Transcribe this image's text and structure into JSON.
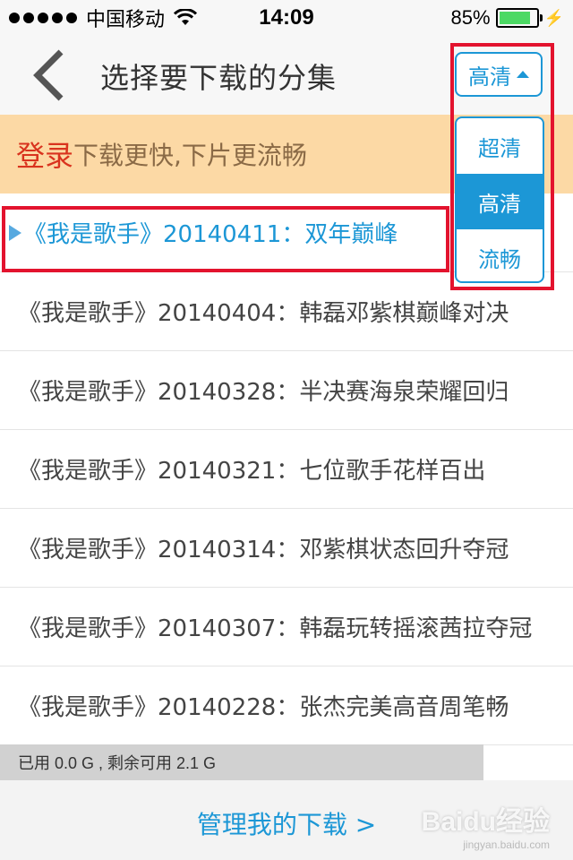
{
  "status_bar": {
    "carrier": "中国移动",
    "time": "14:09",
    "battery_percent": "85%",
    "battery_level": 0.85
  },
  "nav": {
    "title": "选择要下载的分集",
    "quality_selected": "高清",
    "back_icon": "chevron-left-icon"
  },
  "banner": {
    "login": "登录",
    "text": "下载更快,下片更流畅"
  },
  "quality_dropdown": {
    "options": [
      "超清",
      "高清",
      "流畅"
    ],
    "selected_index": 1
  },
  "episodes": [
    "《我是歌手》20140411：双年巅峰",
    "《我是歌手》20140404：韩磊邓紫棋巅峰对决",
    "《我是歌手》20140328：半决赛海泉荣耀回归",
    "《我是歌手》20140321：七位歌手花样百出",
    "《我是歌手》20140314：邓紫棋状态回升夺冠",
    "《我是歌手》20140307：韩磊玩转摇滚茜拉夺冠",
    "《我是歌手》20140228：张杰完美高音周笔畅"
  ],
  "storage": {
    "text": "已用 0.0 G , 剩余可用 2.1 G"
  },
  "bottom": {
    "manage_link": "管理我的下载 >"
  },
  "watermark": {
    "logo": "Baidu经验",
    "sub": "jingyan.baidu.com"
  },
  "colors": {
    "accent": "#1c97d6",
    "login_red": "#d9331e",
    "banner_bg": "#fcd9a5",
    "annotation_red": "#e3132e"
  }
}
